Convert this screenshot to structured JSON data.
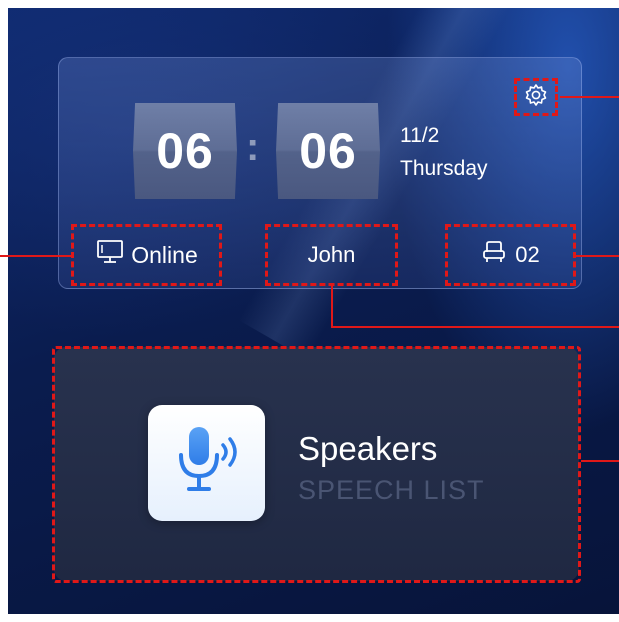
{
  "clock": {
    "hours": "06",
    "separator": ":",
    "minutes": "06"
  },
  "date": {
    "day": "11/2",
    "weekday": "Thursday"
  },
  "status": {
    "connection": "Online",
    "user": "John",
    "seat": "02"
  },
  "speakers_card": {
    "title": "Speakers",
    "subtitle": "SPEECH LIST"
  },
  "icons": [
    "gear-icon",
    "monitor-icon",
    "seat-icon",
    "microphone-icon"
  ],
  "colors": {
    "annotation": "#e01818",
    "mic_blue": "#2f7de8"
  }
}
